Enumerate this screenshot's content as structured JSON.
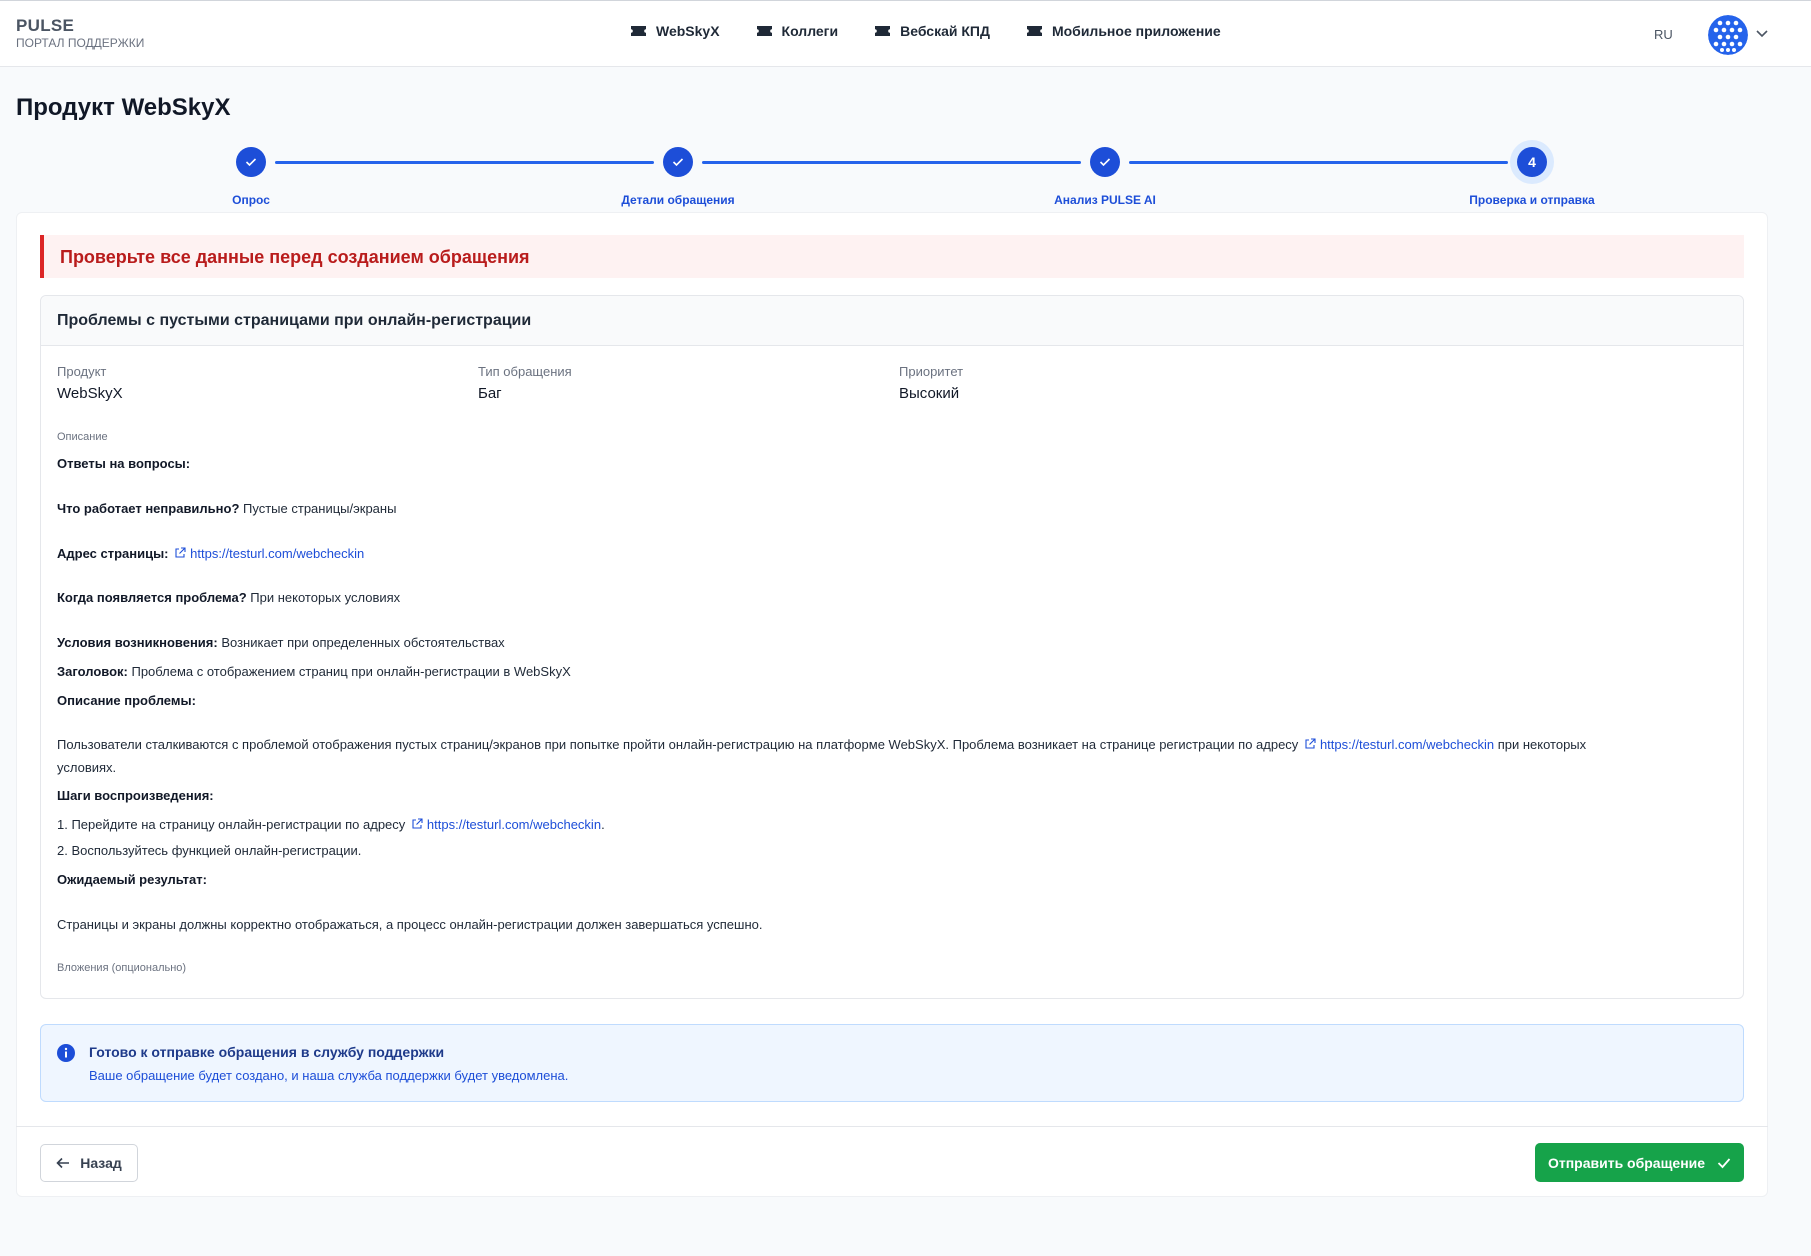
{
  "header": {
    "brand_name": "PULSE",
    "brand_sub": "ПОРТАЛ ПОДДЕРЖКИ",
    "nav": [
      {
        "label": "WebSkyX",
        "icon": "ticket-icon"
      },
      {
        "label": "Коллеги",
        "icon": "ticket-icon"
      },
      {
        "label": "Вебскай КПД",
        "icon": "ticket-icon"
      },
      {
        "label": "Мобильное приложение",
        "icon": "ticket-icon"
      }
    ],
    "language": "RU",
    "avatar_icon": "user-avatar-icon"
  },
  "page_title": "Продукт WebSkyX",
  "stepper": {
    "current_step": 4,
    "steps": [
      {
        "label": "Опрос",
        "status": "completed"
      },
      {
        "label": "Детали обращения",
        "status": "completed"
      },
      {
        "label": "Анализ PULSE AI",
        "status": "completed"
      },
      {
        "label": "Проверка и отправка",
        "status": "active",
        "number": "4"
      }
    ]
  },
  "alert": "Проверьте все данные перед созданием обращения",
  "summary": {
    "title": "Проблемы с пустыми страницами при онлайн-регистрации",
    "fields": {
      "product": {
        "label": "Продукт",
        "value": "WebSkyX"
      },
      "type": {
        "label": "Тип обращения",
        "value": "Баг"
      },
      "priority": {
        "label": "Приоритет",
        "value": "Высокий"
      }
    },
    "description_label": "Описание",
    "description": {
      "answers_heading": "Ответы на вопросы:",
      "q1_label": "Что работает неправильно?",
      "q1_value": "Пустые страницы/экраны",
      "q2_label": "Адрес страницы:",
      "q2_link": "https://testurl.com/webcheckin",
      "q3_label": "Когда появляется проблема?",
      "q3_value": "При некоторых условиях",
      "q4_label": "Условия возникновения:",
      "q4_value": "Возникает при определенных обстоятельствах",
      "q5_label": "Заголовок:",
      "q5_value": "Проблема с отображением страниц при онлайн-регистрации в WebSkyX",
      "problem_heading": "Описание проблемы:",
      "problem_text_a": "Пользователи сталкиваются с проблемой отображения пустых страниц/экранов при попытке пройти онлайн-регистрацию на платформе WebSkyX. Проблема возникает на странице регистрации по адресу",
      "problem_link": "https://testurl.com/webcheckin",
      "problem_text_b": "при некоторых",
      "problem_text_c": "условиях.",
      "steps_heading": "Шаги воспроизведения:",
      "step1_text": "1. Перейдите на страницу онлайн-регистрации по адресу",
      "step1_link": "https://testurl.com/webcheckin",
      "step1_end": ".",
      "step2_text": "2. Воспользуйтесь функцией онлайн-регистрации.",
      "expected_heading": "Ожидаемый результат:",
      "expected_text": "Страницы и экраны должны корректно отображаться, а процесс онлайн-регистрации должен завершаться успешно."
    },
    "attachments_label": "Вложения (опционально)"
  },
  "info": {
    "title": "Готово к отправке обращения в службу поддержки",
    "text": "Ваше обращение будет создано, и наша служба поддержки будет уведомлена."
  },
  "footer": {
    "back_label": "Назад",
    "submit_label": "Отправить обращение"
  },
  "colors": {
    "primary": "#1d4ed8",
    "danger": "#dc2626",
    "success": "#16a34a",
    "info_bg": "#eff6ff"
  }
}
